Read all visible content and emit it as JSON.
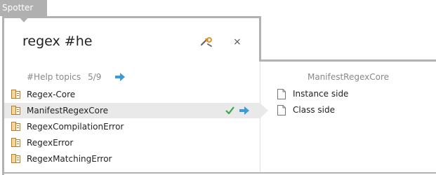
{
  "tab": {
    "label": "Spotter"
  },
  "search": {
    "query": "regex #he"
  },
  "icons": {
    "settings": "wrench-icon",
    "close": "close-icon",
    "class": "class-icon",
    "document": "document-icon",
    "check": "check-icon",
    "dive": "arrow-right-icon"
  },
  "colors": {
    "frame": "#b2b2b2",
    "selection": "#e9e9e9",
    "arrow": "#3c9ad6",
    "check": "#3aa54a"
  },
  "results": {
    "category": {
      "label": "#Help topics",
      "count": "5/9"
    },
    "items": [
      {
        "label": "Regex-Core"
      },
      {
        "label": "ManifestRegexCore",
        "selected": true
      },
      {
        "label": "RegexCompilationError"
      },
      {
        "label": "RegexError"
      },
      {
        "label": "RegexMatchingError"
      }
    ]
  },
  "preview": {
    "title": "ManifestRegexCore",
    "items": [
      {
        "label": "Instance side"
      },
      {
        "label": "Class side"
      }
    ]
  }
}
